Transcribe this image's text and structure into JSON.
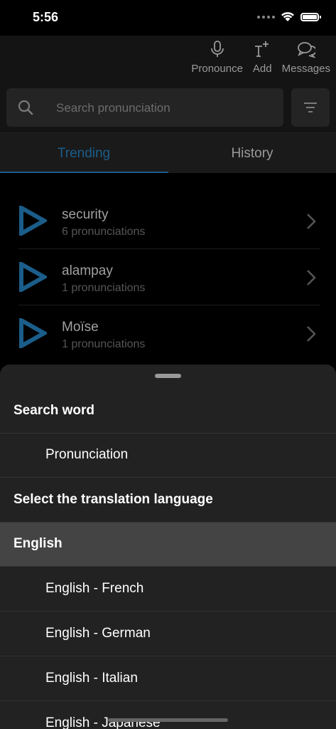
{
  "status_bar": {
    "time": "5:56"
  },
  "toolbar": {
    "pronounce_label": "Pronounce",
    "add_label": "Add",
    "messages_label": "Messages"
  },
  "search": {
    "placeholder": "Search pronunciation"
  },
  "tabs": [
    {
      "label": "Trending",
      "active": true
    },
    {
      "label": "History",
      "active": false
    }
  ],
  "trending": [
    {
      "word": "security",
      "count": "6 pronunciations"
    },
    {
      "word": "alampay",
      "count": "1 pronunciations"
    },
    {
      "word": "Moïse",
      "count": "1 pronunciations"
    }
  ],
  "sheet": {
    "rows": [
      {
        "label": "Search word",
        "type": "header"
      },
      {
        "label": "Pronunciation",
        "type": "item"
      },
      {
        "label": "Select the translation language",
        "type": "header"
      },
      {
        "label": "English",
        "type": "header",
        "selected": true
      },
      {
        "label": "English - French",
        "type": "item"
      },
      {
        "label": "English - German",
        "type": "item"
      },
      {
        "label": "English - Italian",
        "type": "item"
      },
      {
        "label": "English - Japanese",
        "type": "item"
      }
    ]
  },
  "colors": {
    "accent": "#1b5d8a",
    "sheet_bg": "#222222",
    "selected_bg": "#444444"
  }
}
